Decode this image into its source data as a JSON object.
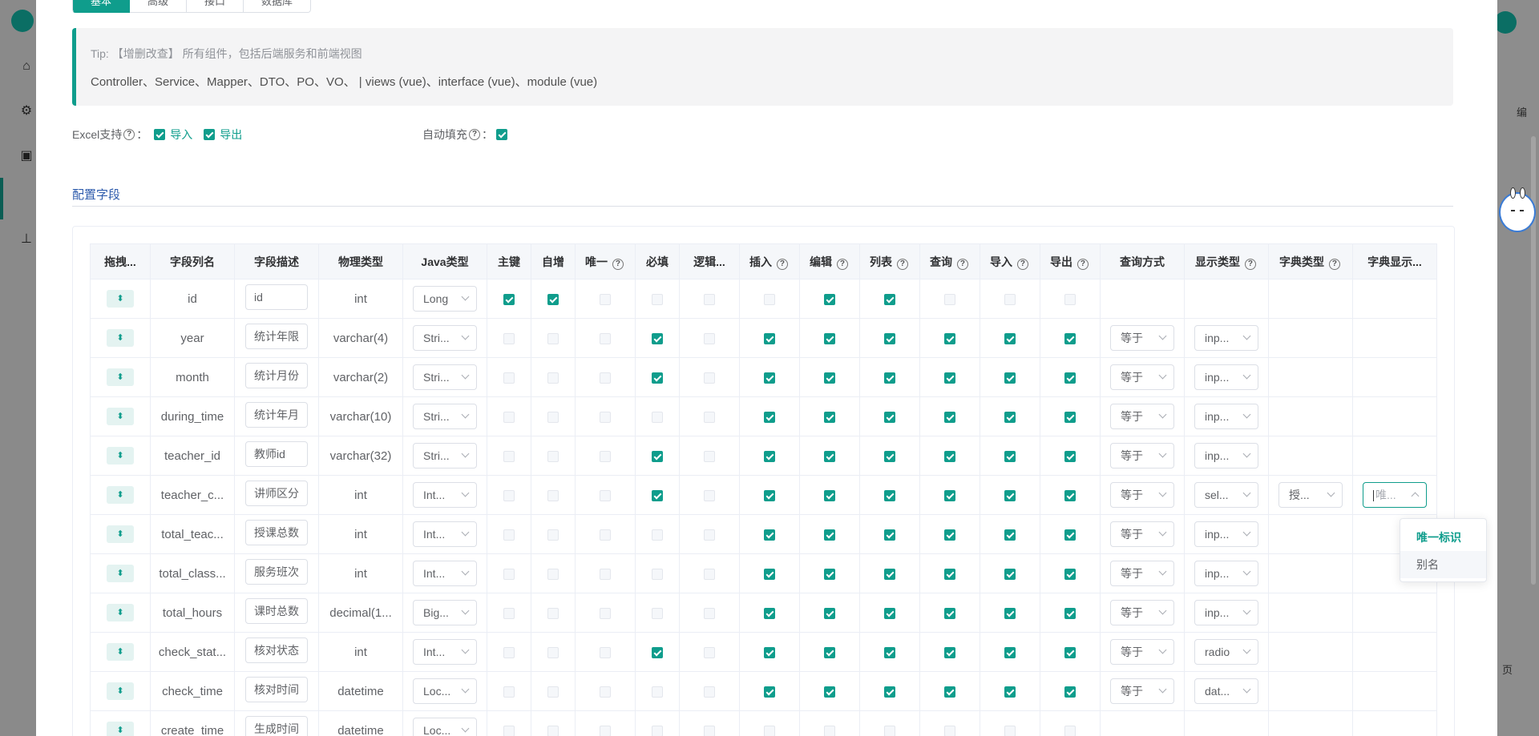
{
  "tabs": [
    "基本",
    "高级",
    "接口",
    "数据库"
  ],
  "tip": {
    "line1": "Tip: 【增删改查】 所有组件，包括后端服务和前端视图",
    "line2": "Controller、Service、Mapper、DTO、PO、VO、 | views (vue)、interface (vue)、module (vue)"
  },
  "options": {
    "excel_label": "Excel支持",
    "import_label": "导入",
    "export_label": "导出",
    "autofill_label": "自动填充"
  },
  "section_title": "配置字段",
  "help_glyph": "?",
  "handle_glyph": "⬍",
  "columns": {
    "drag": "拖拽...",
    "name": "字段列名",
    "desc": "字段描述",
    "phys": "物理类型",
    "java": "Java类型",
    "pk": "主键",
    "auto": "自增",
    "unique": "唯一",
    "required": "必填",
    "logic": "逻辑...",
    "insert": "插入",
    "edit": "编辑",
    "list": "列表",
    "query": "查询",
    "import": "导入",
    "export": "导出",
    "query_mode": "查询方式",
    "display_type": "显示类型",
    "dict_type": "字典类型",
    "dict_display": "字典显示..."
  },
  "rows": [
    {
      "name": "id",
      "desc": "id",
      "phys": "int",
      "java": "Long",
      "checks": [
        1,
        1,
        0,
        0,
        0,
        0,
        1,
        1,
        0,
        0,
        0
      ],
      "disabled": [
        0,
        0,
        1,
        1,
        1,
        1,
        0,
        0,
        1,
        1,
        1
      ],
      "query_mode": "",
      "display_type": "",
      "dict_type": "",
      "dict_display": ""
    },
    {
      "name": "year",
      "desc": "统计年限",
      "phys": "varchar(4)",
      "java": "Stri...",
      "checks": [
        0,
        0,
        0,
        1,
        0,
        1,
        1,
        1,
        1,
        1,
        1
      ],
      "disabled": [
        1,
        1,
        1,
        0,
        1,
        0,
        0,
        0,
        0,
        0,
        0
      ],
      "query_mode": "等于",
      "display_type": "inp...",
      "dict_type": "",
      "dict_display": ""
    },
    {
      "name": "month",
      "desc": "统计月份",
      "phys": "varchar(2)",
      "java": "Stri...",
      "checks": [
        0,
        0,
        0,
        1,
        0,
        1,
        1,
        1,
        1,
        1,
        1
      ],
      "disabled": [
        1,
        1,
        1,
        0,
        1,
        0,
        0,
        0,
        0,
        0,
        0
      ],
      "query_mode": "等于",
      "display_type": "inp...",
      "dict_type": "",
      "dict_display": ""
    },
    {
      "name": "during_time",
      "desc": "统计年月",
      "phys": "varchar(10)",
      "java": "Stri...",
      "checks": [
        0,
        0,
        0,
        0,
        0,
        1,
        1,
        1,
        1,
        1,
        1
      ],
      "disabled": [
        1,
        1,
        1,
        1,
        1,
        0,
        0,
        0,
        0,
        0,
        0
      ],
      "query_mode": "等于",
      "display_type": "inp...",
      "dict_type": "",
      "dict_display": ""
    },
    {
      "name": "teacher_id",
      "desc": "教师id",
      "phys": "varchar(32)",
      "java": "Stri...",
      "checks": [
        0,
        0,
        0,
        1,
        0,
        1,
        1,
        1,
        1,
        1,
        1
      ],
      "disabled": [
        1,
        1,
        1,
        0,
        1,
        0,
        0,
        0,
        0,
        0,
        0
      ],
      "query_mode": "等于",
      "display_type": "inp...",
      "dict_type": "",
      "dict_display": ""
    },
    {
      "name": "teacher_c...",
      "desc": "讲师区分",
      "phys": "int",
      "java": "Int...",
      "checks": [
        0,
        0,
        0,
        1,
        0,
        1,
        1,
        1,
        1,
        1,
        1
      ],
      "disabled": [
        1,
        1,
        1,
        0,
        1,
        0,
        0,
        0,
        0,
        0,
        0
      ],
      "query_mode": "等于",
      "display_type": "sel...",
      "dict_type": "授...",
      "dict_display": "唯..."
    },
    {
      "name": "total_teac...",
      "desc": "授课总数",
      "phys": "int",
      "java": "Int...",
      "checks": [
        0,
        0,
        0,
        0,
        0,
        1,
        1,
        1,
        1,
        1,
        1
      ],
      "disabled": [
        1,
        1,
        1,
        1,
        1,
        0,
        0,
        0,
        0,
        0,
        0
      ],
      "query_mode": "等于",
      "display_type": "inp...",
      "dict_type": "",
      "dict_display": ""
    },
    {
      "name": "total_class...",
      "desc": "服务班次",
      "phys": "int",
      "java": "Int...",
      "checks": [
        0,
        0,
        0,
        0,
        0,
        1,
        1,
        1,
        1,
        1,
        1
      ],
      "disabled": [
        1,
        1,
        1,
        1,
        1,
        0,
        0,
        0,
        0,
        0,
        0
      ],
      "query_mode": "等于",
      "display_type": "inp...",
      "dict_type": "",
      "dict_display": ""
    },
    {
      "name": "total_hours",
      "desc": "课时总数",
      "phys": "decimal(1...",
      "java": "Big...",
      "checks": [
        0,
        0,
        0,
        0,
        0,
        1,
        1,
        1,
        1,
        1,
        1
      ],
      "disabled": [
        1,
        1,
        1,
        1,
        1,
        0,
        0,
        0,
        0,
        0,
        0
      ],
      "query_mode": "等于",
      "display_type": "inp...",
      "dict_type": "",
      "dict_display": ""
    },
    {
      "name": "check_stat...",
      "desc": "核对状态",
      "phys": "int",
      "java": "Int...",
      "checks": [
        0,
        0,
        0,
        1,
        0,
        1,
        1,
        1,
        1,
        1,
        1
      ],
      "disabled": [
        1,
        1,
        1,
        0,
        1,
        0,
        0,
        0,
        0,
        0,
        0
      ],
      "query_mode": "等于",
      "display_type": "radio",
      "dict_type": "",
      "dict_display": ""
    },
    {
      "name": "check_time",
      "desc": "核对时间",
      "phys": "datetime",
      "java": "Loc...",
      "checks": [
        0,
        0,
        0,
        0,
        0,
        1,
        1,
        1,
        1,
        1,
        1
      ],
      "disabled": [
        1,
        1,
        1,
        1,
        1,
        0,
        0,
        0,
        0,
        0,
        0
      ],
      "query_mode": "等于",
      "display_type": "dat...",
      "dict_type": "",
      "dict_display": ""
    },
    {
      "name": "create_time",
      "desc": "生成时间",
      "phys": "datetime",
      "java": "Loc...",
      "checks": [
        0,
        0,
        0,
        0,
        0,
        0,
        0,
        0,
        0,
        0,
        0
      ],
      "disabled": [
        1,
        1,
        1,
        1,
        1,
        1,
        1,
        1,
        1,
        1,
        1
      ],
      "query_mode": "",
      "display_type": "",
      "dict_type": "",
      "dict_display": ""
    }
  ],
  "dropdown": {
    "items": [
      "唯一标识",
      "别名"
    ],
    "selected": "唯一标识",
    "hovered": "别名"
  },
  "background": {
    "page_hint": "页",
    "edit_hint": "编"
  },
  "colors": {
    "primary": "#0f9d8c",
    "link": "#2d5bac"
  }
}
